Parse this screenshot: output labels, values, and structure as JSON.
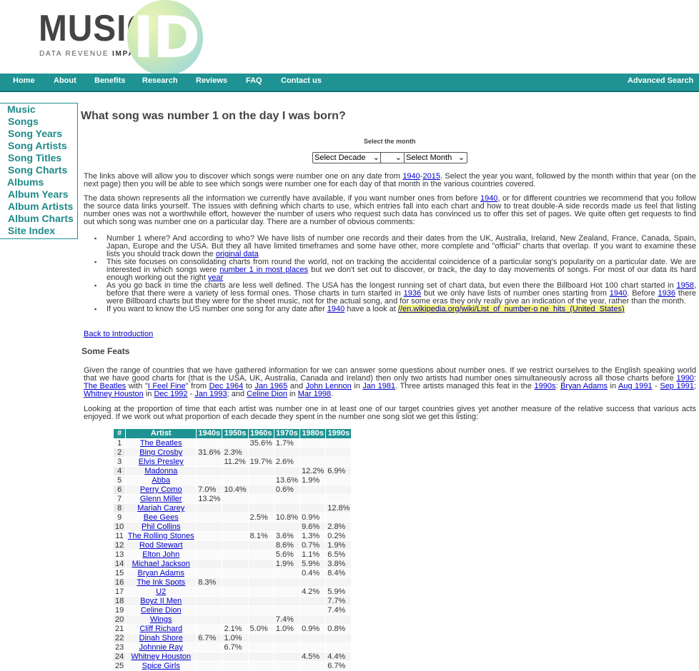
{
  "logo": {
    "main": "MUSIC",
    "sub_plain": "DATA REVENUE ",
    "sub_bold": "IMPACT",
    "mark": "ID"
  },
  "nav": {
    "items": [
      "Home",
      "About",
      "Benefits",
      "Research",
      "Reviews",
      "FAQ",
      "Contact us"
    ],
    "advanced_search": "Advanced Search"
  },
  "sidebar": {
    "items": [
      "Music",
      "Songs",
      "Song Years",
      "Song Artists",
      "Song Titles",
      "Song Charts",
      "Albums",
      "Album Years",
      "Album Artists",
      "Album Charts",
      "Site Index"
    ]
  },
  "page_title": "What song was number 1 on the day I was born?",
  "month_select": {
    "label": "Select the month",
    "decade": "Select Decade",
    "year": "",
    "month": "Select Month"
  },
  "intro": {
    "p1_a": "The links above will allow you to discover which songs were number one on any date from ",
    "p1_link1": "1940",
    "p1_dash": "-",
    "p1_link2": "2015",
    "p1_b": ". Select the year you want, followed by the month within that year (on the next page) then you will be able to see which songs were number one for each day of that month in the various countries covered.",
    "p2_a": "The data shown represents all the information we currently have available, if you want number ones from before ",
    "p2_link": "1940",
    "p2_b": ", or for different countries we recommend that you follow the source data links yourself. The issues with defining which charts to use, which entries fall into each chart and how to treat double-A side records made us feel that listing number ones was not a worthwhile effort, however the number of users who request such data has convinced us to offer this set of pages. We quite often get requests to find out which song was number one on a particular day. There are a number of obvious comments:"
  },
  "bullets": {
    "b1_a": "Number 1 where? And according to who? We have lists of number one records and their dates from the UK, Australia, Ireland, New Zealand, France, Canada, Spain, Japan, Europe and the USA. But they all have limited timeframes and some have other, more complete and \"official\" charts that overlap. If you want to examine these lists you should track down the ",
    "b1_link": "original data",
    "b2_a": "This site focuses on consolidating charts from round the world, not on tracking the accidental coincidence of a particular song's popularity on a particular date. We are interested in which songs were ",
    "b2_link1": "number 1 in most places",
    "b2_b": " but we don't set out to discover, or track, the day to day movements of songs. For most of our data its hard enough working out the right ",
    "b2_link2": "year",
    "b3_a": "As you go back in time the charts are less well defined. The USA has the longest running set of chart data, but even there the Billboard Hot 100 chart started in ",
    "b3_link1": "1958",
    "b3_b": ", before that there were a variety of less formal ones. Those charts in turn started in ",
    "b3_link2": "1936",
    "b3_c": " but we only have lists of number ones starting from ",
    "b3_link3": "1940",
    "b3_d": ". Before ",
    "b3_link4": "1936",
    "b3_e": " there were Billboard charts but they were for the sheet music, not for the actual song, and for some eras they only really give an indication of the year, rather than the month.",
    "b4_a": "If you want to know the US number one song for any date after ",
    "b4_link1": "1940",
    "b4_b": " have a look at ",
    "b4_link2": "//en.wikipedia.org/wiki/List_of_number-o ne_hits_(United_States)"
  },
  "back_link": "Back to Introduction",
  "feats": {
    "heading": "Some Feats",
    "p1_a": "Given the range of countries that we have gathered information for we can answer some questions about number ones. If we restrict ourselves to the English speaking world that we have good charts for (that is the USA, UK, Australia, Canada and Ireland) then only two artists had number ones simultaneously across all those charts before ",
    "p1_l1": "1990",
    "p1_b": ": ",
    "p1_l2": "The Beatles",
    "p1_c": " with \"",
    "p1_l3": "I Feel Fine",
    "p1_d": "\" from ",
    "p1_l4": "Dec 1964",
    "p1_e": " to ",
    "p1_l5": "Jan 1965",
    "p1_f": " and ",
    "p1_l6": "John Lennon",
    "p1_g": " in ",
    "p1_l7": "Jan 1981",
    "p1_h": ". Three artists managed this feat in the ",
    "p1_l8": "1990s",
    "p1_i": ": ",
    "p1_l9": "Bryan Adams",
    "p1_j": " in ",
    "p1_l10": "Aug 1991",
    "p1_k": " - ",
    "p1_l11": "Sep 1991",
    "p1_l": "; ",
    "p1_l12": "Whitney Houston",
    "p1_m": " in ",
    "p1_l13": "Dec 1992",
    "p1_n": " - ",
    "p1_l14": "Jan 1993",
    "p1_o": "; and ",
    "p1_l15": "Celine Dion",
    "p1_p": " in ",
    "p1_l16": "Mar 1998",
    "p1_q": ".",
    "p2": "Looking at the proportion of time that each artist was number one in at least one of our target countries gives yet another measure of the relative success that various acts enjoyed. If we work out what proportion of each decade they spent in the number one song slot we get this listing:"
  },
  "table": {
    "headers": [
      "#",
      "Artist",
      "1940s",
      "1950s",
      "1960s",
      "1970s",
      "1980s",
      "1990s"
    ],
    "rows": [
      [
        "1",
        "The Beatles",
        "",
        "",
        "35.6%",
        "1.7%",
        "",
        ""
      ],
      [
        "2",
        "Bing Crosby",
        "31.6%",
        "2.3%",
        "",
        "",
        "",
        ""
      ],
      [
        "3",
        "Elvis Presley",
        "",
        "11.2%",
        "19.7%",
        "2.6%",
        "",
        ""
      ],
      [
        "4",
        "Madonna",
        "",
        "",
        "",
        "",
        "12.2%",
        "6.9%"
      ],
      [
        "5",
        "Abba",
        "",
        "",
        "",
        "13.6%",
        "1.9%",
        ""
      ],
      [
        "6",
        "Perry Como",
        "7.0%",
        "10.4%",
        "",
        "0.6%",
        "",
        ""
      ],
      [
        "7",
        "Glenn Miller",
        "13.2%",
        "",
        "",
        "",
        "",
        ""
      ],
      [
        "8",
        "Mariah Carey",
        "",
        "",
        "",
        "",
        "",
        "12.8%"
      ],
      [
        "9",
        "Bee Gees",
        "",
        "",
        "2.5%",
        "10.8%",
        "0.9%",
        ""
      ],
      [
        "10",
        "Phil Collins",
        "",
        "",
        "",
        "",
        "9.6%",
        "2.8%"
      ],
      [
        "11",
        "The Rolling Stones",
        "",
        "",
        "8.1%",
        "3.6%",
        "1.3%",
        "0.2%"
      ],
      [
        "12",
        "Rod Stewart",
        "",
        "",
        "",
        "8.6%",
        "0.7%",
        "1.9%"
      ],
      [
        "13",
        "Elton John",
        "",
        "",
        "",
        "5.6%",
        "1.1%",
        "6.5%"
      ],
      [
        "14",
        "Michael Jackson",
        "",
        "",
        "",
        "1.9%",
        "5.9%",
        "3.8%"
      ],
      [
        "15",
        "Bryan Adams",
        "",
        "",
        "",
        "",
        "0.4%",
        "8.4%"
      ],
      [
        "16",
        "The Ink Spots",
        "8.3%",
        "",
        "",
        "",
        "",
        ""
      ],
      [
        "17",
        "U2",
        "",
        "",
        "",
        "",
        "4.2%",
        "5.9%"
      ],
      [
        "18",
        "Boyz II Men",
        "",
        "",
        "",
        "",
        "",
        "7.7%"
      ],
      [
        "19",
        "Celine Dion",
        "",
        "",
        "",
        "",
        "",
        "7.4%"
      ],
      [
        "20",
        "Wings",
        "",
        "",
        "",
        "7.4%",
        "",
        ""
      ],
      [
        "21",
        "Cliff Richard",
        "",
        "2.1%",
        "5.0%",
        "1.0%",
        "0.9%",
        "0.8%"
      ],
      [
        "22",
        "Dinah Shore",
        "6.7%",
        "1.0%",
        "",
        "",
        "",
        ""
      ],
      [
        "23",
        "Johnnie Ray",
        "",
        "6.7%",
        "",
        "",
        "",
        ""
      ],
      [
        "24",
        "Whitney Houston",
        "",
        "",
        "",
        "",
        "4.5%",
        "4.4%"
      ],
      [
        "25",
        "Spice Girls",
        "",
        "",
        "",
        "",
        "",
        "6.7%"
      ]
    ]
  }
}
